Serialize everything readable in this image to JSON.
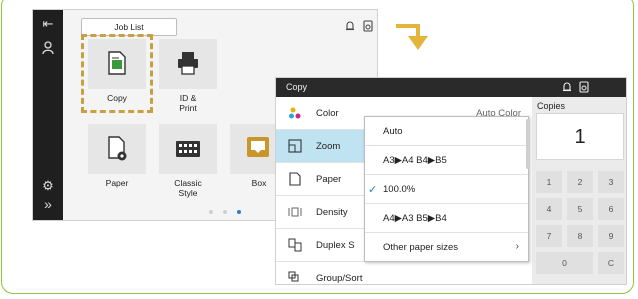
{
  "screen1": {
    "job_list_label": "Job List",
    "tiles": [
      {
        "label": "Copy",
        "icon": "copy-icon"
      },
      {
        "label": "ID &\nPrint",
        "icon": "printer-icon"
      },
      {
        "label": "Paper",
        "icon": "paper-settings-icon"
      },
      {
        "label": "Classic\nStyle",
        "icon": "keyboard-icon"
      },
      {
        "label": "Box",
        "icon": "box-icon"
      }
    ],
    "page_indicator": {
      "pages": 3,
      "current": 3
    }
  },
  "screen2": {
    "title": "Copy",
    "functions": [
      {
        "label": "Color",
        "value": "Auto Color",
        "icon": "color-icon"
      },
      {
        "label": "Zoom",
        "value": "",
        "icon": "zoom-icon"
      },
      {
        "label": "Paper",
        "value": "",
        "icon": "paper-icon"
      },
      {
        "label": "Density",
        "value": "",
        "icon": "density-icon"
      },
      {
        "label": "Duplex S",
        "value": "",
        "icon": "duplex-icon"
      },
      {
        "label": "Group/Sort",
        "value": "",
        "icon": "group-sort-icon"
      }
    ],
    "zoom_menu": [
      {
        "label": "Auto",
        "checked": false,
        "submenu": false
      },
      {
        "label": "A3▶A4  B4▶B5",
        "checked": false,
        "submenu": false
      },
      {
        "label": "100.0%",
        "checked": true,
        "submenu": false
      },
      {
        "label": "A4▶A3  B5▶B4",
        "checked": false,
        "submenu": false
      },
      {
        "label": "Other paper sizes",
        "checked": false,
        "submenu": true
      }
    ],
    "copies_label": "Copies",
    "copies_value": "1",
    "keypad": [
      "1",
      "2",
      "3",
      "4",
      "5",
      "6",
      "7",
      "8",
      "9",
      "0",
      "C"
    ]
  },
  "colors": {
    "accent_border": "#8cc63f",
    "selection_dash": "#c8a041",
    "arrow": "#e3b53b",
    "selected_row": "#bfe3f1",
    "check": "#2a7fc0"
  }
}
